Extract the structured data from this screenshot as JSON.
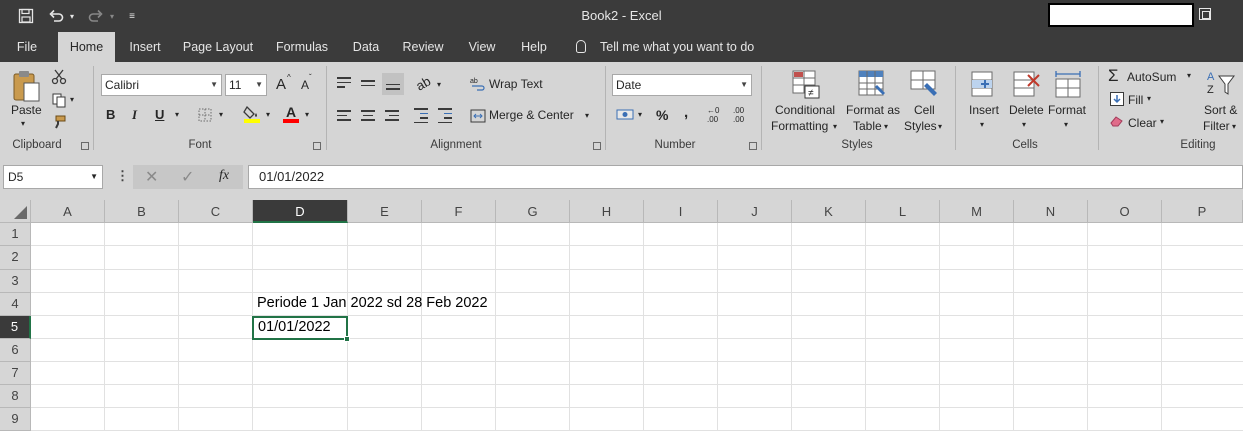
{
  "window": {
    "title": "Book2  -  Excel"
  },
  "menu": {
    "tabs": [
      "File",
      "Home",
      "Insert",
      "Page Layout",
      "Formulas",
      "Data",
      "Review",
      "View",
      "Help"
    ],
    "active_tab": "Home",
    "tell_me": "Tell me what you want to do"
  },
  "ribbon": {
    "clipboard": {
      "paste": "Paste",
      "label": "Clipboard"
    },
    "font": {
      "name": "Calibri",
      "size": "11",
      "bold": "B",
      "italic": "I",
      "underline": "U",
      "grow": "A",
      "shrink": "A",
      "color_a": "A",
      "label": "Font"
    },
    "alignment": {
      "wrap_text": "Wrap Text",
      "merge_center": "Merge & Center",
      "label": "Alignment"
    },
    "number": {
      "format": "Date",
      "percent": "%",
      "comma": ",",
      "inc_decimal": ".00",
      "dec_decimal": ".00",
      "label": "Number"
    },
    "styles": {
      "conditional_1": "Conditional",
      "conditional_2": "Formatting",
      "format_table_1": "Format as",
      "format_table_2": "Table",
      "cell_styles_1": "Cell",
      "cell_styles_2": "Styles",
      "label": "Styles"
    },
    "cells": {
      "insert": "Insert",
      "delete": "Delete",
      "format": "Format",
      "label": "Cells"
    },
    "editing": {
      "autosum": "AutoSum",
      "fill": "Fill",
      "clear": "Clear",
      "sort_1": "Sort &",
      "sort_2": "Filter",
      "label": "Editing"
    },
    "colors": {
      "highlight": "#ffff00",
      "font_color": "#ff0000",
      "accent": "#217346"
    }
  },
  "formula_bar": {
    "name_box": "D5",
    "fx": "fx",
    "value": "01/01/2022"
  },
  "grid": {
    "columns": [
      "A",
      "B",
      "C",
      "D",
      "E",
      "F",
      "G",
      "H",
      "I",
      "J",
      "K",
      "L",
      "M",
      "N",
      "O",
      "P"
    ],
    "selected_column": "D",
    "rows": [
      "1",
      "2",
      "3",
      "4",
      "5",
      "6",
      "7",
      "8",
      "9"
    ],
    "selected_row": "5",
    "cells": {
      "D4": "Periode 1 Jan 2022 sd 28 Feb 2022",
      "D5": "01/01/2022"
    }
  }
}
